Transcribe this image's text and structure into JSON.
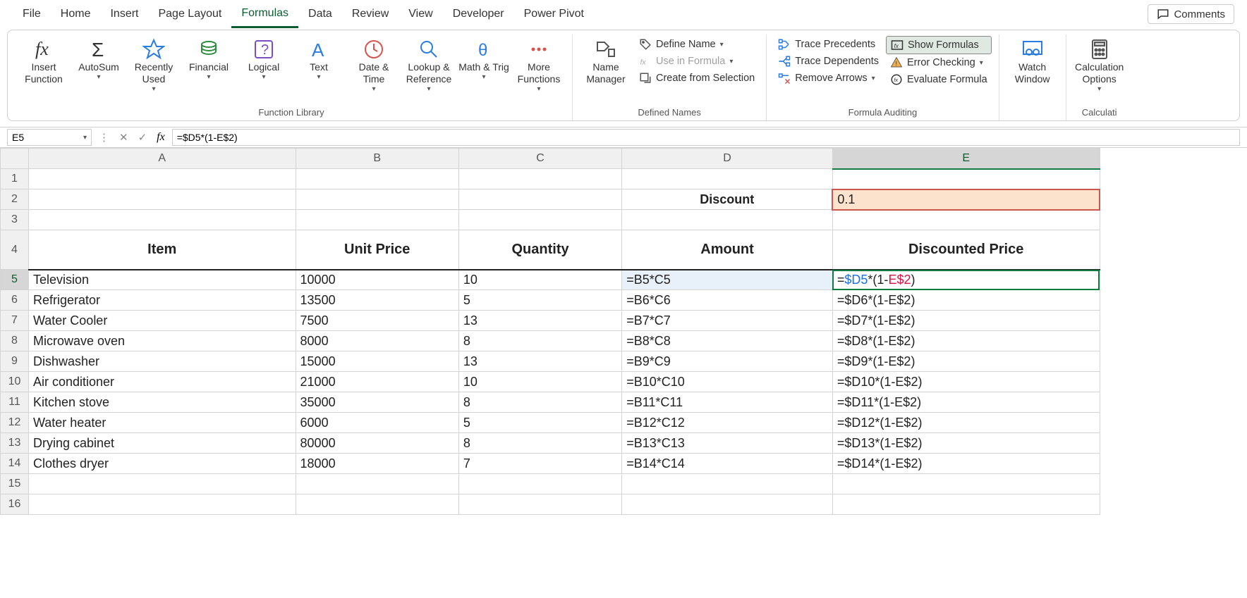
{
  "tabs": [
    "File",
    "Home",
    "Insert",
    "Page Layout",
    "Formulas",
    "Data",
    "Review",
    "View",
    "Developer",
    "Power Pivot"
  ],
  "active_tab": "Formulas",
  "comments_label": "Comments",
  "ribbon": {
    "function_library": {
      "label": "Function Library",
      "insert_function": "Insert Function",
      "autosum": "AutoSum",
      "recently_used": "Recently Used",
      "financial": "Financial",
      "logical": "Logical",
      "text": "Text",
      "date_time": "Date & Time",
      "lookup_ref": "Lookup & Reference",
      "math_trig": "Math & Trig",
      "more_functions": "More Functions"
    },
    "defined_names": {
      "label": "Defined Names",
      "name_manager": "Name Manager",
      "define_name": "Define Name",
      "use_in_formula": "Use in Formula",
      "create_from_selection": "Create from Selection"
    },
    "formula_auditing": {
      "label": "Formula Auditing",
      "trace_precedents": "Trace Precedents",
      "trace_dependents": "Trace Dependents",
      "remove_arrows": "Remove Arrows",
      "show_formulas": "Show Formulas",
      "error_checking": "Error Checking",
      "evaluate_formula": "Evaluate Formula"
    },
    "watch_window": "Watch Window",
    "calculation": {
      "label": "Calculati",
      "calculation_options": "Calculation Options"
    }
  },
  "name_box": "E5",
  "formula_bar": "=$D5*(1-E$2)",
  "columns": [
    "A",
    "B",
    "C",
    "D",
    "E"
  ],
  "rows_visible": 16,
  "discount_label": "Discount",
  "discount_value": "0.1",
  "headers": {
    "A": "Item",
    "B": "Unit Price",
    "C": "Quantity",
    "D": "Amount",
    "E": "Discounted Price"
  },
  "chart_data": {
    "type": "table",
    "columns": [
      "Item",
      "Unit Price",
      "Quantity",
      "Amount",
      "Discounted Price"
    ],
    "rows": [
      {
        "row": 5,
        "A": "Television",
        "B": "10000",
        "C": "10",
        "D": "=B5*C5",
        "E": "=$D5*(1-E$2)"
      },
      {
        "row": 6,
        "A": "Refrigerator",
        "B": "13500",
        "C": "5",
        "D": "=B6*C6",
        "E": "=$D6*(1-E$2)"
      },
      {
        "row": 7,
        "A": "Water Cooler",
        "B": "7500",
        "C": "13",
        "D": "=B7*C7",
        "E": "=$D7*(1-E$2)"
      },
      {
        "row": 8,
        "A": "Microwave oven",
        "B": "8000",
        "C": "8",
        "D": "=B8*C8",
        "E": "=$D8*(1-E$2)"
      },
      {
        "row": 9,
        "A": "Dishwasher",
        "B": "15000",
        "C": "13",
        "D": "=B9*C9",
        "E": "=$D9*(1-E$2)"
      },
      {
        "row": 10,
        "A": "Air conditioner",
        "B": "21000",
        "C": "10",
        "D": "=B10*C10",
        "E": "=$D10*(1-E$2)"
      },
      {
        "row": 11,
        "A": "Kitchen stove",
        "B": "35000",
        "C": "8",
        "D": "=B11*C11",
        "E": "=$D11*(1-E$2)"
      },
      {
        "row": 12,
        "A": "Water heater",
        "B": "6000",
        "C": "5",
        "D": "=B12*C12",
        "E": "=$D12*(1-E$2)"
      },
      {
        "row": 13,
        "A": "Drying cabinet",
        "B": "80000",
        "C": "8",
        "D": "=B13*C13",
        "E": "=$D13*(1-E$2)"
      },
      {
        "row": 14,
        "A": "Clothes dryer",
        "B": "18000",
        "C": "7",
        "D": "=B14*C14",
        "E": "=$D14*(1-E$2)"
      }
    ]
  }
}
